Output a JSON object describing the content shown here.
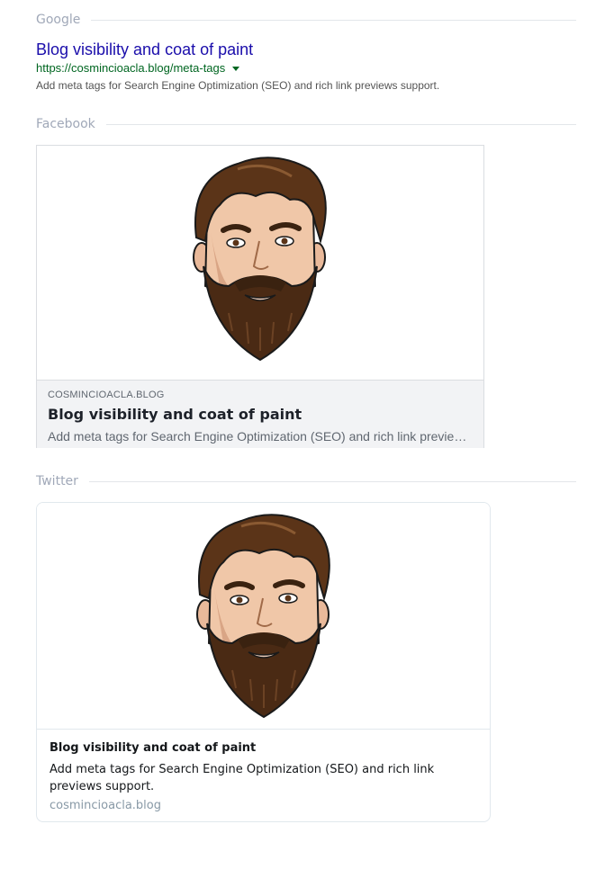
{
  "google": {
    "section_label": "Google",
    "title": "Blog visibility and coat of paint",
    "url": "https://cosmincioacla.blog/meta-tags",
    "description": "Add meta tags for Search Engine Optimization (SEO) and rich link previews support."
  },
  "facebook": {
    "section_label": "Facebook",
    "domain": "COSMINCIOACLA.BLOG",
    "title": "Blog visibility and coat of paint",
    "description": "Add meta tags for Search Engine Optimization (SEO) and rich link previews support."
  },
  "twitter": {
    "section_label": "Twitter",
    "title": "Blog visibility and coat of paint",
    "description": "Add meta tags for Search Engine Optimization (SEO) and rich link previews support.",
    "domain": "cosmincioacla.blog"
  },
  "icons": {
    "google_url_dropdown": "caret-down-icon",
    "preview_image": "bearded-man-avatar"
  },
  "colors": {
    "google_title": "#1a0dab",
    "google_url": "#006621",
    "section_label": "#a0a8b8",
    "fb_meta_bg": "#f2f3f5"
  }
}
